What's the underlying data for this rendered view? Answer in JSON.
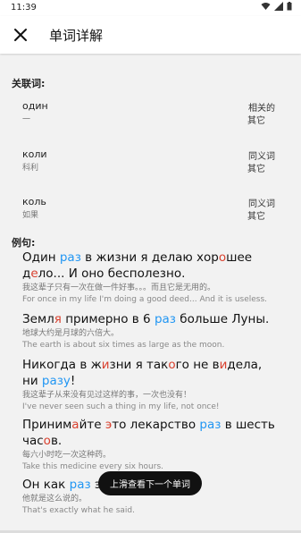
{
  "status": {
    "time": "11:39"
  },
  "appbar": {
    "title": "单词详解"
  },
  "related_label": "关联词:",
  "related": [
    {
      "word": "один",
      "trans": "一",
      "type": "相关的",
      "pos": "其它"
    },
    {
      "word": "коли",
      "trans": "科利",
      "type": "同义词",
      "pos": "其它"
    },
    {
      "word": "коль",
      "trans": "如果",
      "type": "同义词",
      "pos": "其它"
    }
  ],
  "examples_label": "例句:",
  "examples": [
    {
      "ru_segments": [
        [
          "Один ",
          ""
        ],
        [
          "раз",
          "hl"
        ],
        [
          " в жизни я делаю хор",
          ""
        ],
        [
          "о",
          "stress"
        ],
        [
          "шее д",
          ""
        ],
        [
          "е",
          "stress"
        ],
        [
          "ло... И оно бесполезно.",
          ""
        ]
      ],
      "zh": "我这辈子只有一次在做一件好事。。。而且它是无用的。",
      "en": "For once in my life I'm doing a good deed... And it is useless."
    },
    {
      "ru_segments": [
        [
          "Земл",
          ""
        ],
        [
          "я",
          "stress"
        ],
        [
          " примерно в 6 ",
          ""
        ],
        [
          "раз",
          "hl"
        ],
        [
          " больше Луны.",
          ""
        ]
      ],
      "zh": "地球大约是月球的六倍大。",
      "en": "The earth is about six times as large as the moon."
    },
    {
      "ru_segments": [
        [
          "Никогда в ж",
          ""
        ],
        [
          "и",
          "stress"
        ],
        [
          "зни я так",
          ""
        ],
        [
          "о",
          "stress"
        ],
        [
          "го не в",
          ""
        ],
        [
          "и",
          "stress"
        ],
        [
          "дела, ни ",
          ""
        ],
        [
          "разу",
          "hl"
        ],
        [
          "!",
          ""
        ]
      ],
      "zh": "我这辈子从来没有见过这样的事，一次也没有！",
      "en": "I've never seen such a thing in my life, not once!"
    },
    {
      "ru_segments": [
        [
          "Приним",
          ""
        ],
        [
          "а",
          "stress"
        ],
        [
          "йте ",
          ""
        ],
        [
          "э",
          "stress"
        ],
        [
          "то лекарство ",
          ""
        ],
        [
          "раз",
          "hl"
        ],
        [
          " в шесть час",
          ""
        ],
        [
          "о",
          "stress"
        ],
        [
          "в.",
          ""
        ]
      ],
      "zh": "每六小时吃一次这种药。",
      "en": "Take this medicine every six hours."
    },
    {
      "ru_segments": [
        [
          "Он как ",
          ""
        ],
        [
          "раз",
          "hl"
        ],
        [
          " это сказал.",
          ""
        ]
      ],
      "zh": "他就是这么说的。",
      "en": "That's exactly what he said."
    }
  ],
  "toast": "上滑查看下一个单词",
  "colors": {
    "stress": "#d9412f",
    "highlight": "#2196f3"
  }
}
